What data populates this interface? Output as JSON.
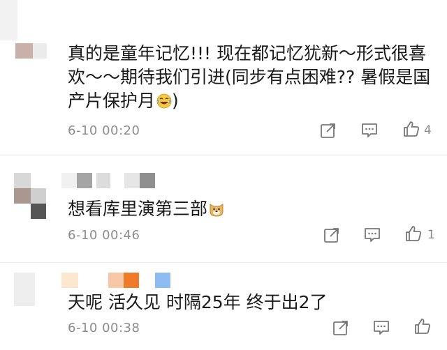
{
  "comments": [
    {
      "text": "真的是童年记忆!!! 现在都记忆犹新～形式很喜欢～～期待我们引进(同步有点困难?? 暑假是国产片保护月",
      "text_tail": ")",
      "emoji": "laughing-emoji",
      "time": "6-10 00:20",
      "like_count": "4"
    },
    {
      "text": "想看库里演第三部",
      "text_tail": "",
      "emoji": "doge-emoji",
      "time": "6-10 00:46",
      "like_count": "1"
    },
    {
      "text": "天呢 活久见 时隔25年 终于出2了",
      "text_tail": "",
      "emoji": "",
      "time": "6-10 00:38",
      "like_count": ""
    }
  ],
  "icons": {
    "share": "share-icon",
    "reply": "comment-icon",
    "like": "thumbs-up-icon"
  },
  "colors": {
    "text": "#1a1a1a",
    "meta": "#8c8c8c",
    "icon": "#777777"
  }
}
